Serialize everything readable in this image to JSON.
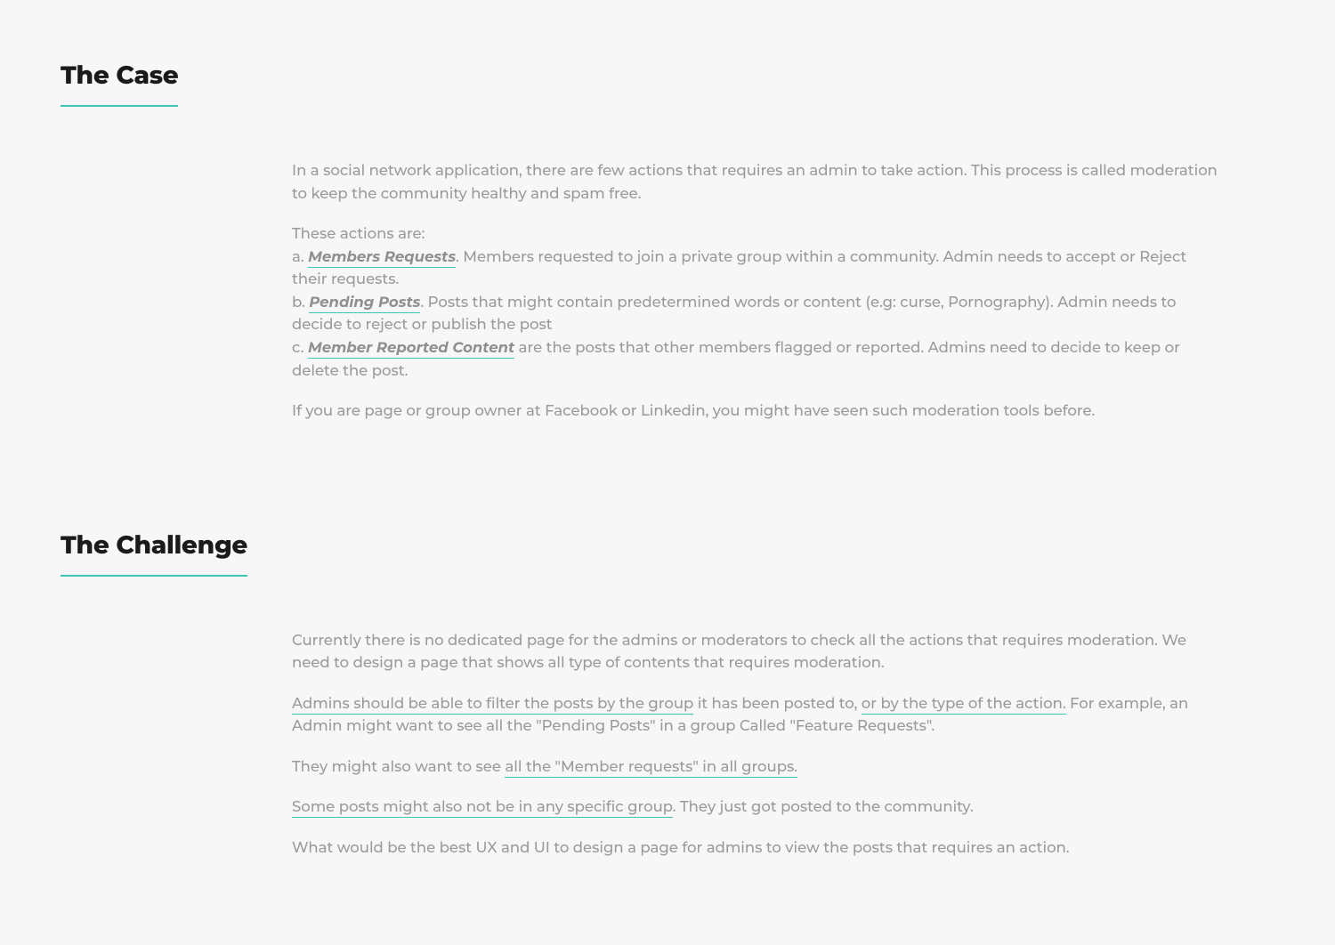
{
  "sections": {
    "case": {
      "heading": "The Case",
      "intro": "In a social network application, there are few actions that requires an admin to take action. This process is called moderation to keep the community healthy and spam free.",
      "actionsTitle": "These actions are:",
      "actions": [
        {
          "prefix": "a.",
          "highlight": "Members Requests",
          "period": ".",
          "rest": " Members requested to join a private group within a community. Admin needs to accept or Reject their requests."
        },
        {
          "prefix": "b.",
          "highlight": "Pending Posts",
          "period": ".",
          "rest": " Posts that might contain predetermined words or content (e.g: curse, Pornography). Admin needs to decide to reject or publish the post"
        },
        {
          "prefix": "c.",
          "highlight": "Member Reported Content",
          "period": "",
          "rest": " are the posts that other members flagged or reported. Admins need to decide to keep or delete the post."
        }
      ],
      "outro": "If you are page or group owner at Facebook or Linkedin, you might have seen such moderation tools before."
    },
    "challenge": {
      "heading": "The Challenge",
      "p1": "Currently there is no dedicated page for the admins or moderators to check all the actions that requires moderation. We need to design a page that shows all type of contents that requires moderation.",
      "p2_u1": "Admins should be able to filter the posts by the group",
      "p2_mid": " it has been posted to, ",
      "p2_u2": "or by the type of the action.",
      "p2_rest": " For example, an Admin might want to see all the \"Pending Posts\" in a group Called \"Feature Requests\".",
      "p3_pre": "They might also want to see ",
      "p3_u": "all the \"Member requests\" in all groups.",
      "p4_u": "Some posts might also not be in any specific group",
      "p4_rest": ". They just got posted to the community.",
      "p5": "What would be the best UX and UI to design a page for admins to view the posts that requires an action."
    }
  }
}
